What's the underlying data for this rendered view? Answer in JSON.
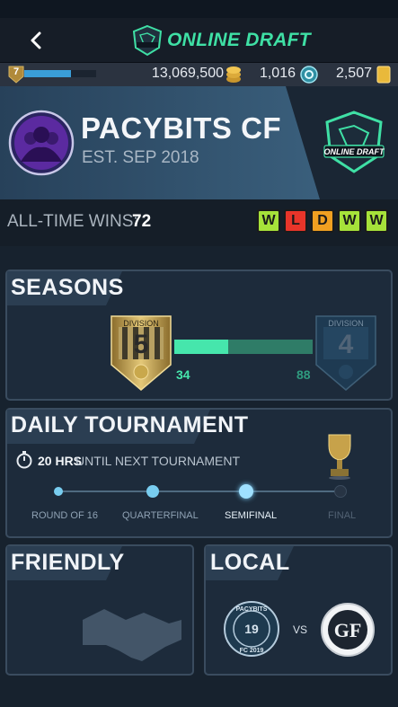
{
  "header": {
    "title": "ONLINE DRAFT",
    "back_icon": "chevron-left-icon",
    "logo_icon": "online-draft-badge-icon"
  },
  "currency": {
    "level": "7",
    "xp_fraction": 0.65,
    "coins": "13,069,500",
    "points": "1,016",
    "tokens": "2,507",
    "coin_icon": "coin-stack-icon",
    "point_icon": "points-icon",
    "token_icon": "token-card-icon"
  },
  "club": {
    "name": "PACYBITS CF",
    "established": "EST. SEP 2018",
    "logo_text": "ONLINE DRAFT",
    "avatar_icon": "club-avatar-icon"
  },
  "wins": {
    "label": "ALL-TIME WINS:",
    "value": "72",
    "form": [
      {
        "result": "W",
        "color": "#a6e23a"
      },
      {
        "result": "L",
        "color": "#e8352a"
      },
      {
        "result": "D",
        "color": "#f0a021"
      },
      {
        "result": "W",
        "color": "#a6e23a"
      },
      {
        "result": "W",
        "color": "#a6e23a"
      }
    ]
  },
  "seasons": {
    "title": "SEASONS",
    "current_division_label": "DIVISION",
    "current_division": "5",
    "next_division_label": "DIVISION",
    "next_division": "4",
    "progress_value": "34",
    "progress_target": "88",
    "progress_fraction": 0.39
  },
  "daily": {
    "title": "DAILY TOURNAMENT",
    "hours": "20 HRS",
    "timer_text": "UNTIL NEXT TOURNAMENT",
    "rounds": [
      "ROUND OF 16",
      "QUARTERFINAL",
      "SEMIFINAL",
      "FINAL"
    ],
    "current_round_index": 2
  },
  "friendly": {
    "title": "FRIENDLY"
  },
  "local": {
    "title": "LOCAL",
    "vs": "VS",
    "crest_left_top": "PACYBITS",
    "crest_left_number": "19",
    "crest_left_bottom": "FC 2019",
    "crest_right": "GF"
  },
  "colors": {
    "accent": "#3fe0a5",
    "card_border": "#3a4c5f",
    "card_bg": "#1d2b3b"
  }
}
